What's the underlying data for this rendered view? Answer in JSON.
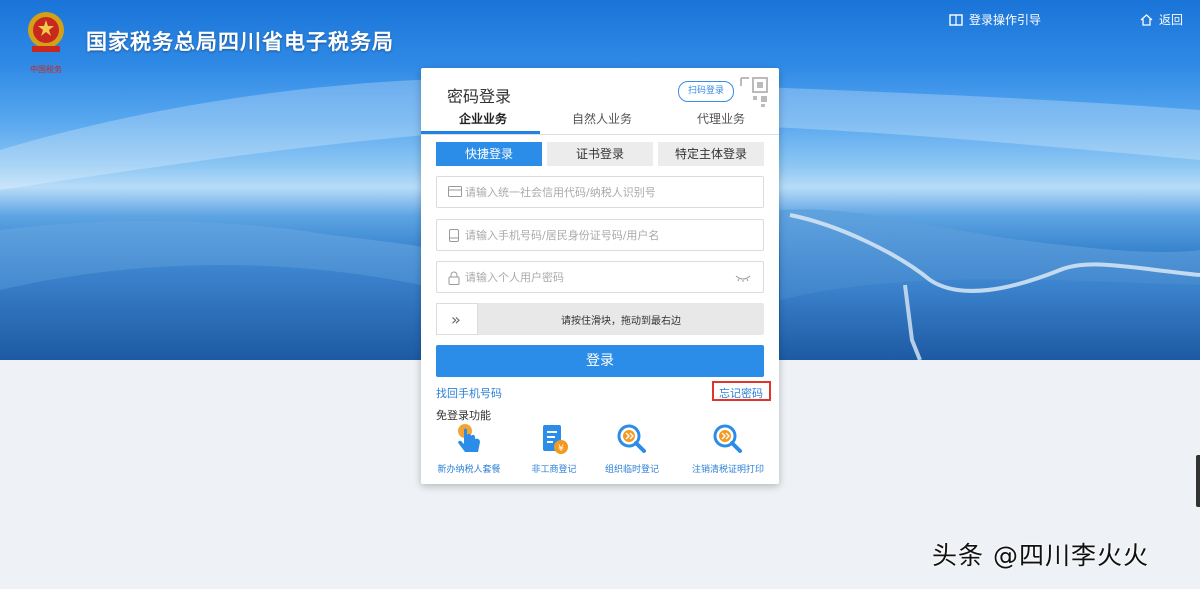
{
  "header": {
    "site_title": "国家税务总局四川省电子税务局",
    "guide_link": "登录操作引导",
    "back_link": "返回",
    "emblem_caption": "中国税务"
  },
  "login_card": {
    "title": "密码登录",
    "scan_button": "扫码登录",
    "tabs": [
      {
        "label": "企业业务",
        "active": true
      },
      {
        "label": "自然人业务",
        "active": false
      },
      {
        "label": "代理业务",
        "active": false
      }
    ],
    "subtabs": [
      {
        "label": "快捷登录",
        "active": true
      },
      {
        "label": "证书登录",
        "active": false
      },
      {
        "label": "特定主体登录",
        "active": false
      }
    ],
    "fields": {
      "credit_code_placeholder": "请输入统一社会信用代码/纳税人识别号",
      "account_placeholder": "请输入手机号码/居民身份证号码/用户名",
      "password_placeholder": "请输入个人用户密码"
    },
    "slider": {
      "handle_glyph": "»",
      "text": "请按住滑块，拖动到最右边"
    },
    "login_button": "登录",
    "recover_phone_link": "找回手机号码",
    "forgot_password_link": "忘记密码",
    "quick_section_label": "免登录功能",
    "quick_actions": [
      {
        "label": "新办纳税人套餐",
        "icon": "hand-pointer-icon"
      },
      {
        "label": "非工商登记",
        "icon": "document-yen-icon"
      },
      {
        "label": "组织临时登记",
        "icon": "magnifier-arrow-icon"
      },
      {
        "label": "注销清税证明打印",
        "icon": "magnifier-arrow-icon"
      }
    ]
  },
  "watermark": "头条 @四川李火火",
  "colors": {
    "accent": "#2b8de8",
    "highlight_box": "#e0352b"
  }
}
